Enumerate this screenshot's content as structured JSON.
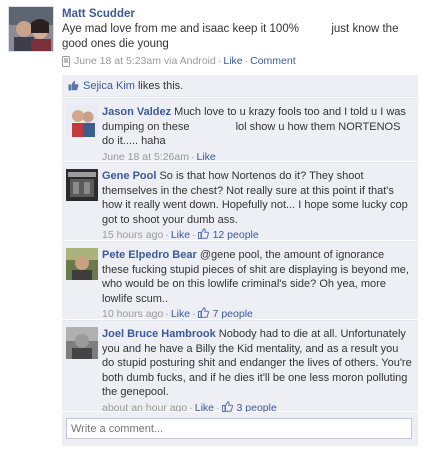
{
  "post": {
    "author": "Matt Scudder",
    "text": "Aye mad love from me and isaac keep it 100%",
    "text_tail": "just know the good ones die young",
    "timestamp": "June 18 at 5:23am via Android",
    "like_label": "Like",
    "comment_label": "Comment"
  },
  "likes": {
    "name": "Sejica Kim",
    "suffix": "likes this."
  },
  "comments": [
    {
      "author": "Jason Valdez",
      "text_a": "Much love to u krazy fools too and I told u I was dumping on these",
      "text_b": "lol show u how them NORTENOS do it..... haha",
      "time": "June 18 at 5:26am",
      "like_label": "Like",
      "like_count": ""
    },
    {
      "author": "Gene Pool",
      "text_a": "So is that how Nortenos do it? They shoot themselves in the chest? Not really sure at this point if that's how it really went down. Hopefully not... I hope some lucky cop got to shoot your dumb ass.",
      "text_b": "",
      "time": "15 hours ago",
      "like_label": "Like",
      "like_count": "12 people"
    },
    {
      "author": "Pete Elpedro Bear",
      "text_a": "@gene pool, the amount of ignorance these fucking stupid pieces of shit are displaying is beyond me, who would be on this lowlife criminal's side? Oh yea, more lowlife scum..",
      "text_b": "",
      "time": "10 hours ago",
      "like_label": "Like",
      "like_count": "7 people"
    },
    {
      "author": "Joel Bruce Hambrook",
      "text_a": "Nobody had to die at all. Unfortunately you and he have a Billy the Kid mentality, and as a result you do stupid posturing shit and endanger the lives of others. You're both dumb fucks, and if he dies it'll be one less moron polluting the genepool.",
      "text_b": "",
      "time": "about an hour ago",
      "like_label": "Like",
      "like_count": "3 people"
    }
  ],
  "composer": {
    "placeholder": "Write a comment..."
  },
  "colors": {
    "link": "#3b5998",
    "comment_bg": "#edeff4",
    "meta": "#999999"
  }
}
